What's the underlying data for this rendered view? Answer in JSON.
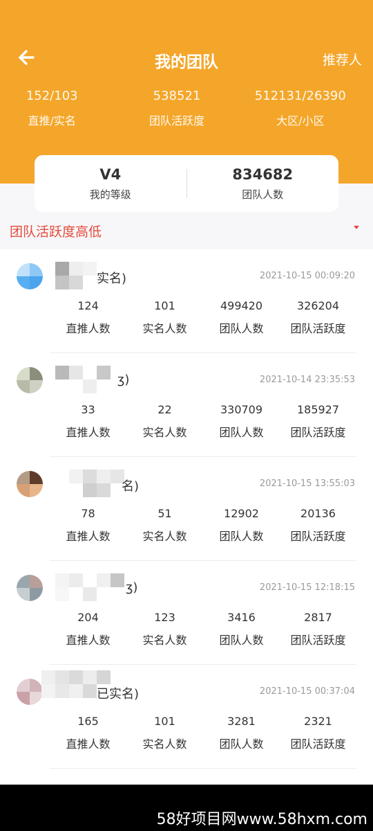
{
  "header": {
    "title": "我的团队",
    "referrer_label": "推荐人",
    "stats": [
      {
        "value": "152/103",
        "label": "直推/实名"
      },
      {
        "value": "538521",
        "label": "团队活跃度"
      },
      {
        "value": "512131/26390",
        "label": "大区/小区"
      }
    ]
  },
  "summary_card": {
    "level_value": "V4",
    "level_label": "我的等级",
    "team_value": "834682",
    "team_label": "团队人数"
  },
  "sort": {
    "label": "团队活跃度高低"
  },
  "members": [
    {
      "name_suffix": "实名)",
      "time": "2021-10-15 00:09:20",
      "values": [
        "124",
        "101",
        "499420",
        "326204"
      ]
    },
    {
      "name_suffix": "ʒ)",
      "time": "2021-10-14 23:35:53",
      "values": [
        "33",
        "22",
        "330709",
        "185927"
      ]
    },
    {
      "name_suffix": "名)",
      "time": "2021-10-15 13:55:03",
      "values": [
        "78",
        "51",
        "12902",
        "20136"
      ]
    },
    {
      "name_suffix": "ʒ)",
      "time": "2021-10-15 12:18:15",
      "values": [
        "204",
        "123",
        "3416",
        "2817"
      ]
    },
    {
      "name_suffix": "已实名)",
      "time": "2021-10-15 00:37:04",
      "values": [
        "165",
        "101",
        "3281",
        "2321"
      ]
    }
  ],
  "metric_labels": [
    "直推人数",
    "实名人数",
    "团队人数",
    "团队活跃度"
  ],
  "watermark": "58好项目网www.58hxm.com",
  "colors": {
    "accent": "#f4a62a",
    "sort": "#e64a3b"
  }
}
